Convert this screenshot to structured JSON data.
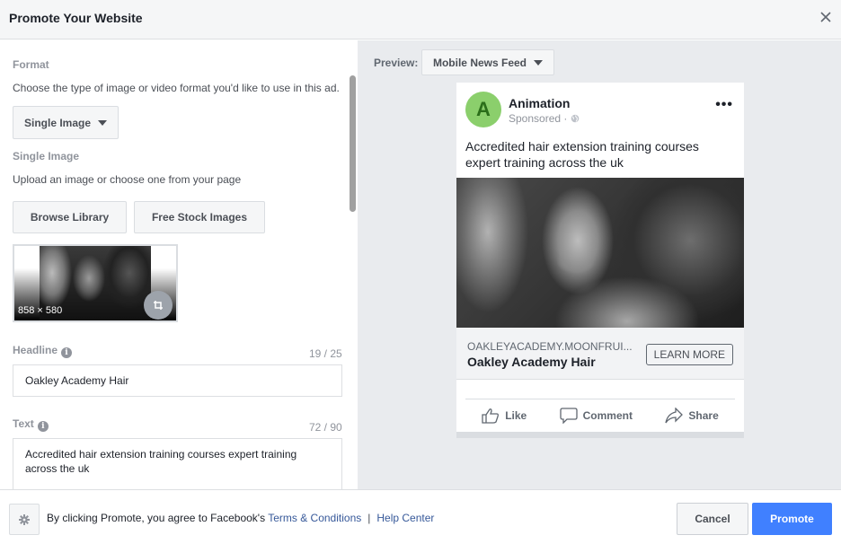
{
  "header": {
    "title": "Promote Your Website",
    "close_icon": "close-icon"
  },
  "format": {
    "label": "Format",
    "description": "Choose the type of image or video format you'd like to use in this ad.",
    "selected": "Single Image"
  },
  "single_image": {
    "label": "Single Image",
    "description": "Upload an image or choose one from your page",
    "browse_label": "Browse Library",
    "stock_label": "Free Stock Images",
    "thumbnail_dimensions": "858 × 580"
  },
  "headline": {
    "label": "Headline",
    "counter": "19 / 25",
    "value": "Oakley Academy Hair"
  },
  "text": {
    "label": "Text",
    "counter": "72 / 90",
    "value": "Accredited hair extension training courses expert training across the uk"
  },
  "preview": {
    "label": "Preview:",
    "selected": "Mobile News Feed",
    "page_initial": "A",
    "page_name": "Animation",
    "sponsored": "Sponsored ·",
    "post_text": "Accredited hair extension training courses expert training across the uk",
    "domain": "OAKLEYACADEMY.MOONFRUI...",
    "headline": "Oakley Academy Hair",
    "cta": "LEARN MORE",
    "actions": [
      "Like",
      "Comment",
      "Share"
    ]
  },
  "footer": {
    "legal_prefix": "By clicking Promote, you agree to Facebook's",
    "terms_link": "Terms & Conditions",
    "separator": "|",
    "help_link": "Help Center",
    "cancel_label": "Cancel",
    "promote_label": "Promote"
  },
  "colors": {
    "primary": "#4080ff",
    "link": "#365899",
    "avatar_bg": "#8bcf6c"
  }
}
